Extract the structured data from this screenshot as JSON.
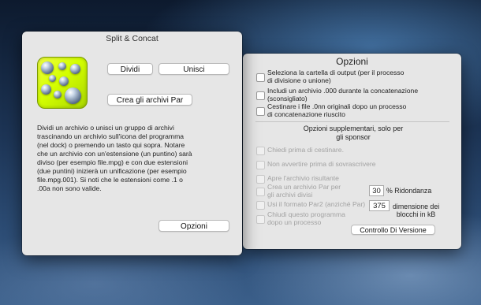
{
  "split_window": {
    "title": "Split & Concat",
    "buttons": {
      "divide": "Dividi",
      "join": "Unisci",
      "create_par": "Crea gli archivi Par",
      "options": "Opzioni"
    },
    "description_lines": [
      "Dividi un archivio o unisci un gruppo di archivi",
      "trascinando un archivio sull'icona del programma",
      "(nel dock) o premendo un tasto qui sopra. Notare",
      "che un archivio con un'estensione (un puntino) sarà",
      "diviso (per esempio file.mpg) e con due estensioni",
      "(due puntini) inizierà un unificazione (per esempio",
      "file.mpg.001). Si noti che le estensioni come .1 o",
      ".00a non sono valide."
    ]
  },
  "options_window": {
    "title": "Opzioni",
    "options": [
      {
        "lines": [
          "Seleziona la cartella di output (per il processo",
          "di divisione o unione)"
        ],
        "checked": false,
        "enabled": true
      },
      {
        "lines": [
          "Includi un archivio .000 durante la concatenazione",
          "(sconsigliato)"
        ],
        "checked": false,
        "enabled": true
      },
      {
        "lines": [
          "Cestinare i file .0nn originali dopo un processo",
          "di concatenazione riuscito"
        ],
        "checked": false,
        "enabled": true
      }
    ],
    "supplementary_title_lines": [
      "Opzioni supplementari, solo per",
      "gli sponsor"
    ],
    "sponsor_options": [
      {
        "lines": [
          "Chiedi prima di cestinare."
        ],
        "checked": false,
        "enabled": false
      },
      {
        "lines": [
          "Non avvertire prima di sovrascrivere"
        ],
        "checked": false,
        "enabled": false
      },
      {
        "lines": [
          "Apre l'archivio risultante"
        ],
        "checked": false,
        "enabled": false
      },
      {
        "lines": [
          "Crea un archivio Par per",
          "gli archivi divisi"
        ],
        "checked": false,
        "enabled": false
      },
      {
        "lines": [
          "Usi il formato Par2 (anziché Par)"
        ],
        "checked": false,
        "enabled": false
      },
      {
        "lines": [
          "Chiudi questo programma",
          "dopo un processo"
        ],
        "checked": false,
        "enabled": false
      }
    ],
    "redundancy": {
      "value": "30",
      "label": "% Ridondanza"
    },
    "block_size": {
      "value": "375",
      "label_lines": [
        "dimensione dei",
        "blocchi in kB"
      ]
    },
    "version_button": "Controllo Di Versione"
  }
}
